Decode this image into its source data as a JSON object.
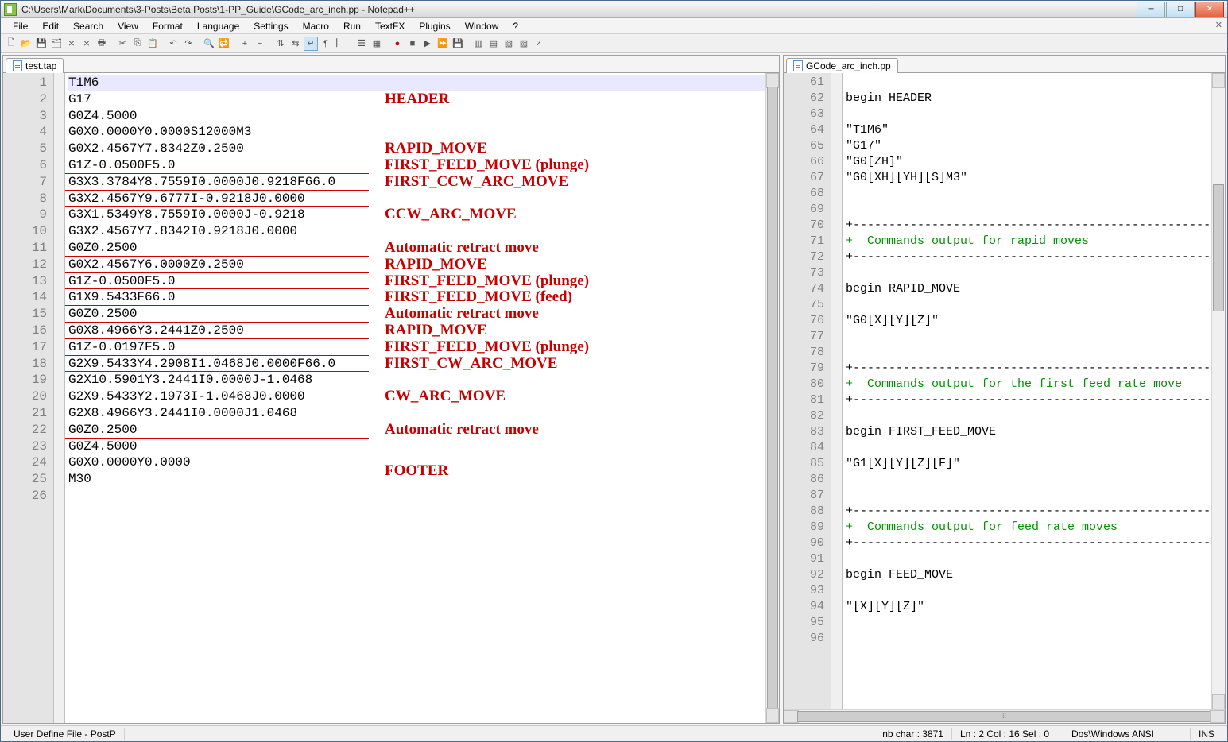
{
  "title": "C:\\Users\\Mark\\Documents\\3-Posts\\Beta Posts\\1-PP_Guide\\GCode_arc_inch.pp - Notepad++",
  "menus": [
    "File",
    "Edit",
    "Search",
    "View",
    "Format",
    "Language",
    "Settings",
    "Macro",
    "Run",
    "TextFX",
    "Plugins",
    "Window",
    "?"
  ],
  "tabs": {
    "left": "test.tap",
    "right": "GCode_arc_inch.pp"
  },
  "left_lines": [
    "T1M6",
    "G17",
    "G0Z4.5000",
    "G0X0.0000Y0.0000S12000M3",
    "G0X2.4567Y7.8342Z0.2500",
    "G1Z-0.0500F5.0",
    "G3X3.3784Y8.7559I0.0000J0.9218F66.0",
    "G3X2.4567Y9.6777I-0.9218J0.0000",
    "G3X1.5349Y8.7559I0.0000J-0.9218",
    "G3X2.4567Y7.8342I0.9218J0.0000",
    "G0Z0.2500",
    "G0X2.4567Y6.0000Z0.2500",
    "G1Z-0.0500F5.0",
    "G1X9.5433F66.0",
    "G0Z0.2500",
    "G0X8.4966Y3.2441Z0.2500",
    "G1Z-0.0197F5.0",
    "G2X9.5433Y4.2908I1.0468J0.0000F66.0",
    "G2X10.5901Y3.2441I0.0000J-1.0468",
    "G2X9.5433Y2.1973I-1.0468J0.0000",
    "G2X8.4966Y3.2441I0.0000J1.0468",
    "G0Z0.2500",
    "G0Z4.5000",
    "G0X0.0000Y0.0000",
    "M30",
    ""
  ],
  "left_red_rules_after": [
    0,
    4,
    5,
    6,
    7,
    10,
    11,
    12,
    13,
    14,
    15,
    16,
    17,
    18,
    21,
    25
  ],
  "annotations": [
    {
      "row": 2,
      "text": "HEADER"
    },
    {
      "row": 5,
      "text": "RAPID_MOVE"
    },
    {
      "row": 6,
      "text": "FIRST_FEED_MOVE (plunge)"
    },
    {
      "row": 7,
      "text": "FIRST_CCW_ARC_MOVE"
    },
    {
      "row": 9,
      "text": "CCW_ARC_MOVE"
    },
    {
      "row": 11,
      "text": "Automatic retract move"
    },
    {
      "row": 12,
      "text": "RAPID_MOVE"
    },
    {
      "row": 13,
      "text": "FIRST_FEED_MOVE (plunge)"
    },
    {
      "row": 14,
      "text": "FIRST_FEED_MOVE (feed)"
    },
    {
      "row": 15,
      "text": "Automatic retract move"
    },
    {
      "row": 16,
      "text": "RAPID_MOVE"
    },
    {
      "row": 17,
      "text": "FIRST_FEED_MOVE (plunge)"
    },
    {
      "row": 18,
      "text": "FIRST_CW_ARC_MOVE"
    },
    {
      "row": 20,
      "text": "CW_ARC_MOVE"
    },
    {
      "row": 22,
      "text": "Automatic retract move"
    },
    {
      "row": 24.5,
      "text": "FOOTER"
    }
  ],
  "right_start": 61,
  "right_lines": [
    {
      "t": ""
    },
    {
      "t": "begin HEADER"
    },
    {
      "t": ""
    },
    {
      "t": "\"T1M6\""
    },
    {
      "t": "\"G17\""
    },
    {
      "t": "\"G0[ZH]\""
    },
    {
      "t": "\"G0[XH][YH][S]M3\""
    },
    {
      "t": ""
    },
    {
      "t": ""
    },
    {
      "t": "+---------------------------------------------------"
    },
    {
      "t": "+  Commands output for rapid moves",
      "green": true
    },
    {
      "t": "+---------------------------------------------------"
    },
    {
      "t": ""
    },
    {
      "t": "begin RAPID_MOVE"
    },
    {
      "t": ""
    },
    {
      "t": "\"G0[X][Y][Z]\""
    },
    {
      "t": ""
    },
    {
      "t": ""
    },
    {
      "t": "+---------------------------------------------------"
    },
    {
      "t": "+  Commands output for the first feed rate move",
      "green": true
    },
    {
      "t": "+---------------------------------------------------"
    },
    {
      "t": ""
    },
    {
      "t": "begin FIRST_FEED_MOVE"
    },
    {
      "t": ""
    },
    {
      "t": "\"G1[X][Y][Z][F]\""
    },
    {
      "t": ""
    },
    {
      "t": ""
    },
    {
      "t": "+---------------------------------------------------"
    },
    {
      "t": "+  Commands output for feed rate moves",
      "green": true
    },
    {
      "t": "+---------------------------------------------------"
    },
    {
      "t": ""
    },
    {
      "t": "begin FEED_MOVE"
    },
    {
      "t": ""
    },
    {
      "t": "\"[X][Y][Z]\""
    },
    {
      "t": ""
    },
    {
      "t": ""
    }
  ],
  "status": {
    "left": "User Define File - PostP",
    "chars": "nb char : 3871",
    "pos": "Ln : 2   Col : 16   Sel : 0",
    "enc": "Dos\\Windows   ANSI",
    "ins": "INS"
  }
}
